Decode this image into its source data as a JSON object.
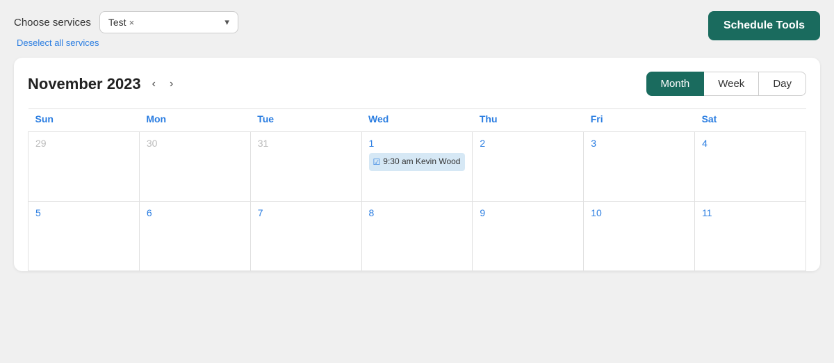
{
  "topbar": {
    "choose_services_label": "Choose services",
    "service_tag": "Test",
    "service_tag_remove": "×",
    "deselect_label": "Deselect all services",
    "schedule_tools_label": "Schedule Tools",
    "chevron": "▾"
  },
  "calendar": {
    "title": "November 2023",
    "prev_nav": "‹",
    "next_nav": "›",
    "views": [
      "Month",
      "Week",
      "Day"
    ],
    "active_view": "Month",
    "days_of_week": [
      "Sun",
      "Mon",
      "Tue",
      "Wed",
      "Thu",
      "Fri",
      "Sat"
    ],
    "weeks": [
      {
        "days": [
          {
            "num": "29",
            "inactive": true,
            "events": []
          },
          {
            "num": "30",
            "inactive": true,
            "events": []
          },
          {
            "num": "31",
            "inactive": true,
            "events": []
          },
          {
            "num": "1",
            "inactive": false,
            "events": [
              {
                "time": "9:30 am",
                "name": "Kevin Wood"
              }
            ]
          },
          {
            "num": "2",
            "inactive": false,
            "events": []
          },
          {
            "num": "3",
            "inactive": false,
            "events": []
          },
          {
            "num": "4",
            "inactive": false,
            "events": []
          }
        ]
      },
      {
        "days": [
          {
            "num": "5",
            "inactive": false,
            "events": []
          },
          {
            "num": "6",
            "inactive": false,
            "events": []
          },
          {
            "num": "7",
            "inactive": false,
            "events": []
          },
          {
            "num": "8",
            "inactive": false,
            "events": []
          },
          {
            "num": "9",
            "inactive": false,
            "events": []
          },
          {
            "num": "10",
            "inactive": false,
            "events": []
          },
          {
            "num": "11",
            "inactive": false,
            "events": []
          }
        ]
      }
    ]
  }
}
